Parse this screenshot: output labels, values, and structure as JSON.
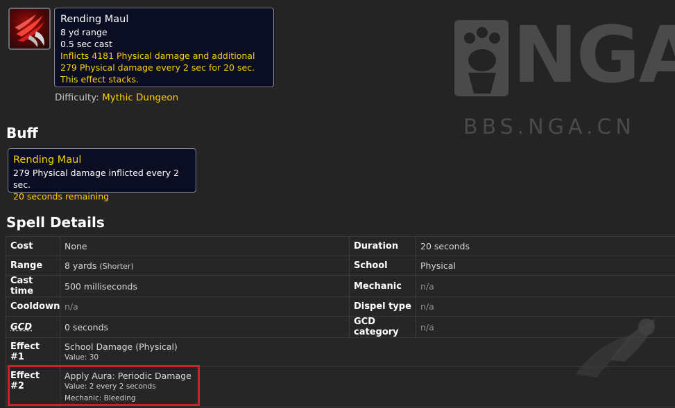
{
  "spell_tooltip": {
    "icon": "rending-maul-claw-icon",
    "title": "Rending Maul",
    "range": "8 yd range",
    "cast": "0.5 sec cast",
    "description": "Inflicts 4181 Physical damage and additional 279 Physical damage every 2 sec for 20 sec. This effect stacks."
  },
  "difficulty": {
    "label": "Difficulty:",
    "value": "Mythic Dungeon"
  },
  "buff_section": {
    "heading": "Buff",
    "title": "Rending Maul",
    "line": "279 Physical damage inflicted every 2 sec.",
    "remaining": "20 seconds remaining"
  },
  "spell_details": {
    "heading": "Spell Details",
    "rows": [
      {
        "label": "Cost",
        "value": "None",
        "label2": "Duration",
        "value2": "20 seconds"
      },
      {
        "label": "Range",
        "value": "8 yards",
        "value_note": "(Shorter)",
        "label2": "School",
        "value2": "Physical"
      },
      {
        "label": "Cast time",
        "value": "500 milliseconds",
        "label2": "Mechanic",
        "value2": "n/a"
      },
      {
        "label": "Cooldown",
        "value": "n/a",
        "label2": "Dispel type",
        "value2": "n/a"
      },
      {
        "label": "GCD",
        "value": "0 seconds",
        "label2": "GCD category",
        "value2": "n/a"
      }
    ],
    "effects": [
      {
        "label": "Effect #1",
        "name": "School Damage (Physical)",
        "lines": [
          "Value: 30"
        ]
      },
      {
        "label": "Effect #2",
        "name": "Apply Aura: Periodic Damage",
        "lines": [
          "Value: 2 every 2 seconds",
          "Mechanic: Bleeding"
        ]
      }
    ]
  },
  "watermark": {
    "logo_letters": "NGA",
    "text": "BBS.NGA.CN"
  },
  "colors": {
    "accent_yellow": "#ffd100",
    "highlight_red": "#d0202a",
    "tooltip_bg": "#0b0e22"
  }
}
